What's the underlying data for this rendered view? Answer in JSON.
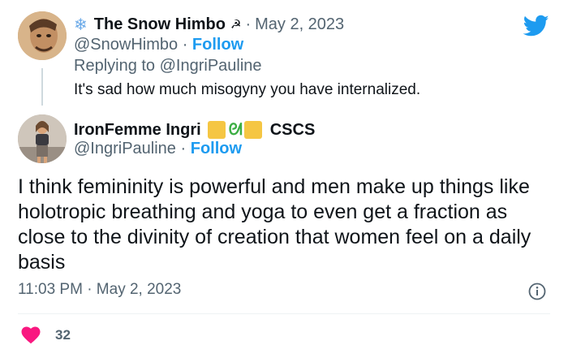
{
  "reply": {
    "display_name": "The Snow Himbo",
    "name_prefix_emoji": "❄",
    "name_suffix_emoji": "☭",
    "separator": "·",
    "date": "May 2, 2023",
    "handle": "@SnowHimbo",
    "follow_label": "Follow",
    "replying_prefix": "Replying to",
    "replying_to": "@IngriPauline",
    "text": "It's sad how much misogyny you have internalized."
  },
  "main": {
    "display_name": "IronFemme Ingri",
    "name_suffix_text": "CSCS",
    "handle": "@IngriPauline",
    "follow_label": "Follow",
    "separator": "·",
    "text": "I think femininity is powerful and men make up things like holotropic breathing and yoga to even get a fraction as close to the divinity of creation that women feel on a daily basis",
    "timestamp": "11:03 PM · May 2, 2023"
  },
  "engagement": {
    "likes": "32"
  },
  "icons": {
    "platform": "twitter-bird-icon",
    "info": "info-icon",
    "like": "heart-icon"
  },
  "colors": {
    "accent": "#1d9bf0",
    "heart": "#f91880",
    "secondary_text": "#536471"
  }
}
